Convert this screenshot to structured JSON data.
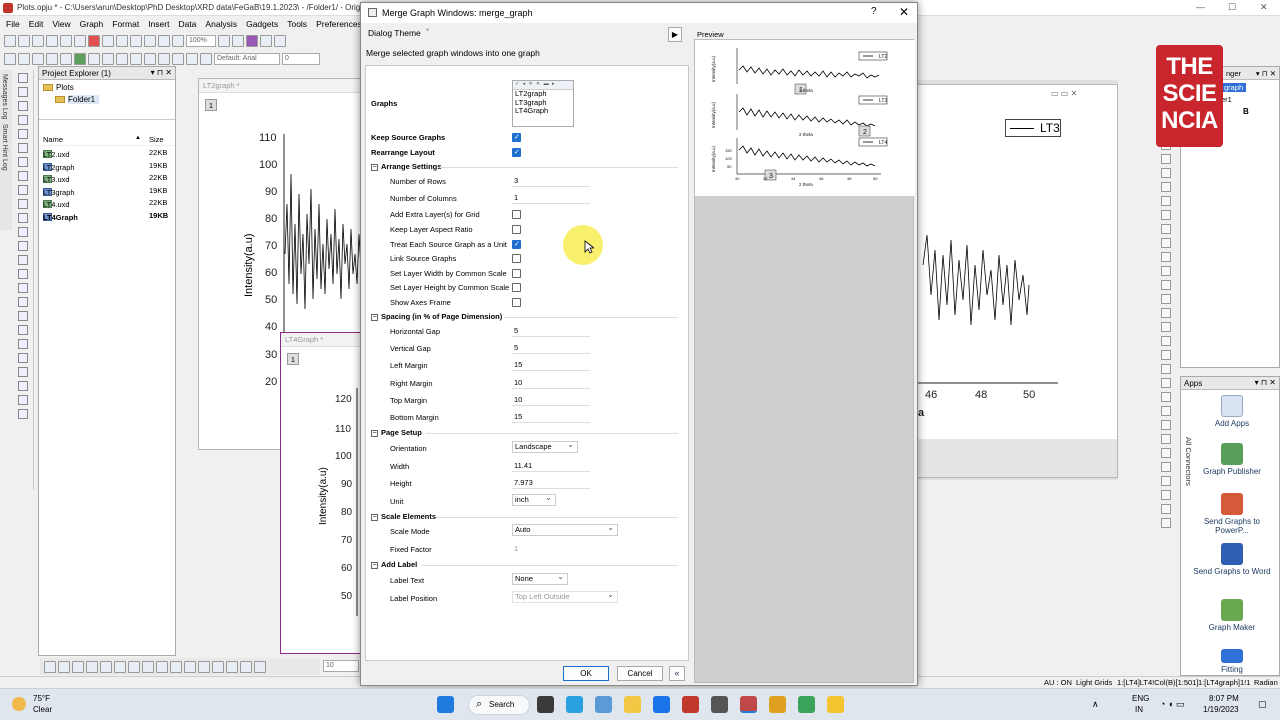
{
  "window_title": "Plots.opju * - C:\\Users\\arun\\Desktop\\PhD Desktop\\XRD data\\FeGaB\\19.1.2023\\ - /Folder1/ - Origin",
  "menu": [
    "File",
    "Edit",
    "View",
    "Graph",
    "Format",
    "Insert",
    "Data",
    "Analysis",
    "Gadgets",
    "Tools",
    "Preferences"
  ],
  "toolbar": {
    "zoom": "100%",
    "font": "Default: Arial",
    "font_size": "0"
  },
  "side_tabs": [
    "Messages Log",
    "Smart Hint Log"
  ],
  "project_explorer": {
    "title": "Project Explorer (1)",
    "root": "Plots",
    "folder": "Folder1",
    "col_name": "Name",
    "col_size": "Size",
    "files": [
      {
        "name": "LT2.uxd",
        "size": "22KB"
      },
      {
        "name": "LT2graph",
        "size": "19KB"
      },
      {
        "name": "LT3.uxd",
        "size": "22KB"
      },
      {
        "name": "LT3graph",
        "size": "19KB"
      },
      {
        "name": "LT4.uxd",
        "size": "22KB"
      },
      {
        "name": "LT4Graph",
        "size": "19KB"
      }
    ]
  },
  "bg_graph_1": {
    "title": "LT2graph *",
    "layer": "1",
    "ylabel": "Intensity(a.u)",
    "yticks": [
      "110",
      "100",
      "90",
      "80",
      "70",
      "60",
      "50",
      "40",
      "30",
      "20"
    ]
  },
  "bg_graph_2": {
    "title": "LT4Graph *",
    "layer": "1",
    "ylabel": "Intensity(a.u)",
    "yticks": [
      "120",
      "110",
      "100",
      "90",
      "80",
      "70",
      "60",
      "50"
    ],
    "bottom_field": "10"
  },
  "bg_graph_3": {
    "legend": "LT3",
    "xticks": [
      "46",
      "48",
      "50"
    ],
    "axis_fragment": "a"
  },
  "right_panel": {
    "title": "nger",
    "item1": "graph",
    "item2": "er1",
    "item3": "B"
  },
  "logo_text": [
    "THE",
    "SCIE",
    "NCIA"
  ],
  "apps_panel": {
    "title": "Apps",
    "side_tab": "All Connectors",
    "items": [
      "Add Apps",
      "Graph Publisher",
      "Send Graphs to PowerP...",
      "Send Graphs to Word",
      "Graph Maker",
      "Fitting"
    ]
  },
  "status_bar": {
    "mode": "AU : ON",
    "grid": "Light Grids",
    "col": "1:[LT4]LT4!Col(B)[1:501]",
    "layer": "1:[LT4graph]1!1",
    "unit": "Radian"
  },
  "dialog": {
    "title": "Merge Graph Windows: merge_graph",
    "help": "?",
    "close": "✕",
    "theme_label": "Dialog Theme",
    "theme_value": "*",
    "description": "Merge selected graph windows into one graph",
    "graphs_label": "Graphs",
    "graphs": [
      "LT2graph",
      "LT3graph",
      "LT4Graph"
    ],
    "keep_source": "Keep Source Graphs",
    "rearrange": "Rearrange Layout",
    "sections": {
      "arrange": "Arrange Settings",
      "spacing": "Spacing (in % of Page Dimension)",
      "page": "Page Setup",
      "scale": "Scale Elements",
      "label": "Add Label"
    },
    "arrange": {
      "rows_label": "Number of Rows",
      "rows": "3",
      "cols_label": "Number of Columns",
      "cols": "1",
      "extra_layers": "Add Extra Layer(s) for Grid",
      "aspect": "Keep Layer Aspect Ratio",
      "as_unit": "Treat Each Source Graph as a Unit",
      "link": "Link Source Graphs",
      "width_common": "Set Layer Width by Common Scale",
      "height_common": "Set Layer Height by Common Scale",
      "axes_frame": "Show Axes Frame"
    },
    "spacing": {
      "hgap_label": "Horizontal Gap",
      "hgap": "5",
      "vgap_label": "Vertical Gap",
      "vgap": "5",
      "left_label": "Left Margin",
      "left": "15",
      "right_label": "Right Margin",
      "right": "10",
      "top_label": "Top Margin",
      "top": "10",
      "bottom_label": "Bottom Margin",
      "bottom": "15"
    },
    "page": {
      "orient_label": "Orientation",
      "orient": "Landscape",
      "width_label": "Width",
      "width": "11.41",
      "height_label": "Height",
      "height": "7.973",
      "unit_label": "Unit",
      "unit": "inch"
    },
    "scale": {
      "mode_label": "Scale Mode",
      "mode": "Auto",
      "factor_label": "Fixed Factor",
      "factor": "1"
    },
    "label": {
      "text_label": "Label Text",
      "text": "None",
      "pos_label": "Label Position",
      "pos": "Top Left Outside"
    },
    "preview_label": "Preview",
    "preview": {
      "ylabel": "Intensity(a.u)",
      "xlabel": "2 theta",
      "legends": [
        "LT2",
        "LT3",
        "LT4"
      ],
      "badges": [
        "1",
        "2",
        "3"
      ],
      "yticks": [
        "150",
        "100",
        "50"
      ],
      "xticks": [
        "40",
        "42",
        "44",
        "46",
        "48",
        "50"
      ]
    },
    "ok": "OK",
    "cancel": "Cancel",
    "collapse": "«"
  },
  "taskbar": {
    "weather_temp": "75°F",
    "weather_desc": "Clear",
    "search": "Search",
    "lang1": "ENG",
    "lang2": "IN",
    "time": "8:07 PM",
    "date": "1/19/2023"
  }
}
